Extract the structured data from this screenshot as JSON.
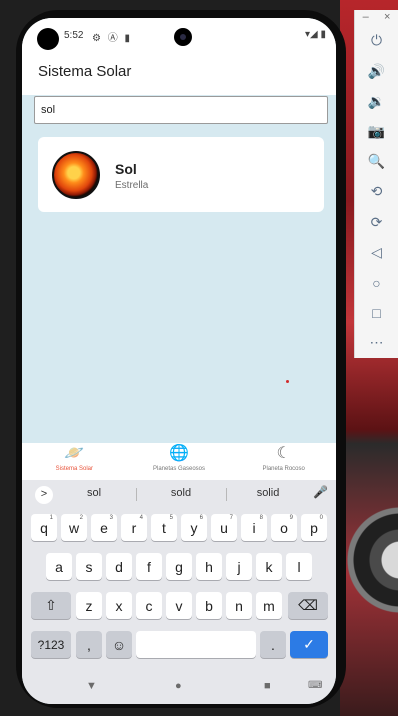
{
  "app": {
    "title": "Sistema Solar"
  },
  "status_bar": {
    "time": "5:52",
    "icons": "⚙ Ⓐ ▮",
    "right": "▾◢ ▮"
  },
  "search": {
    "value": "sol",
    "placeholder": ""
  },
  "results": [
    {
      "title": "Sol",
      "subtitle": "Estrella",
      "image": "sun-image"
    }
  ],
  "bottom_nav": {
    "items": [
      {
        "label": "Sistema Solar",
        "icon": "planet-icon",
        "active": true
      },
      {
        "label": "Planetas Gaseosos",
        "icon": "globe-icon",
        "active": false
      },
      {
        "label": "Planeta Rocoso",
        "icon": "moon-icon",
        "active": false
      }
    ],
    "accent_color": "#e8533a"
  },
  "keyboard": {
    "suggestions": [
      "sol",
      "sold",
      "solid"
    ],
    "row1": [
      "q",
      "w",
      "e",
      "r",
      "t",
      "y",
      "u",
      "i",
      "o",
      "p"
    ],
    "row1_numbers": [
      "1",
      "2",
      "3",
      "4",
      "5",
      "6",
      "7",
      "8",
      "9",
      "0"
    ],
    "row2": [
      "a",
      "s",
      "d",
      "f",
      "g",
      "h",
      "j",
      "k",
      "l"
    ],
    "row3": [
      "z",
      "x",
      "c",
      "v",
      "b",
      "n",
      "m"
    ],
    "shift": "⇧",
    "backspace": "⌫",
    "symbols": "?123",
    "comma": ",",
    "emoji": "☺",
    "period": ".",
    "enter": "✓",
    "expand": ">",
    "mic": "🎤"
  },
  "system_nav": {
    "back": "▼",
    "home": "●",
    "recents": "■",
    "keyboard": "⌨"
  },
  "emulator_toolbar": {
    "window_buttons": [
      "–",
      "×"
    ],
    "buttons": [
      "⏻",
      "🔊",
      "🔉",
      "📷",
      "🔍",
      "⟲",
      "⟳",
      "◁",
      "○",
      "□",
      "⋯"
    ]
  }
}
